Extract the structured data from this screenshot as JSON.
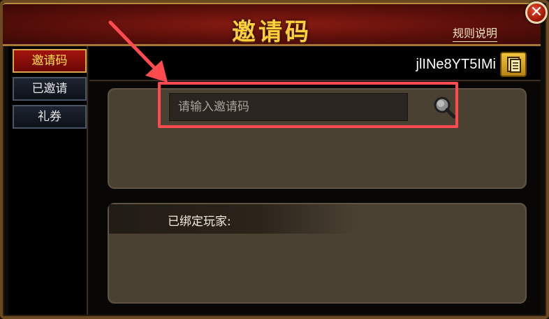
{
  "window": {
    "title": "邀请码",
    "rules_link": "规则说明",
    "close_glyph": "✕"
  },
  "sidebar": {
    "tabs": [
      {
        "label": "邀请码",
        "active": true
      },
      {
        "label": "已邀请",
        "active": false
      },
      {
        "label": "礼券",
        "active": false
      }
    ]
  },
  "invite": {
    "my_code": "jlINe8YT5IMi",
    "input_value": "",
    "input_placeholder": "请输入邀请码"
  },
  "bound": {
    "label": "已绑定玩家:"
  },
  "icons": {
    "close": "close-icon",
    "copy": "copy-icon",
    "search": "search-icon",
    "arrow": "annotation-arrow-icon"
  },
  "colors": {
    "title_gold": "#ffcf3a",
    "tab_active_bg": "#a4140e",
    "annotation_red": "#ff4a4f",
    "panel_bg": "#4a4132"
  }
}
